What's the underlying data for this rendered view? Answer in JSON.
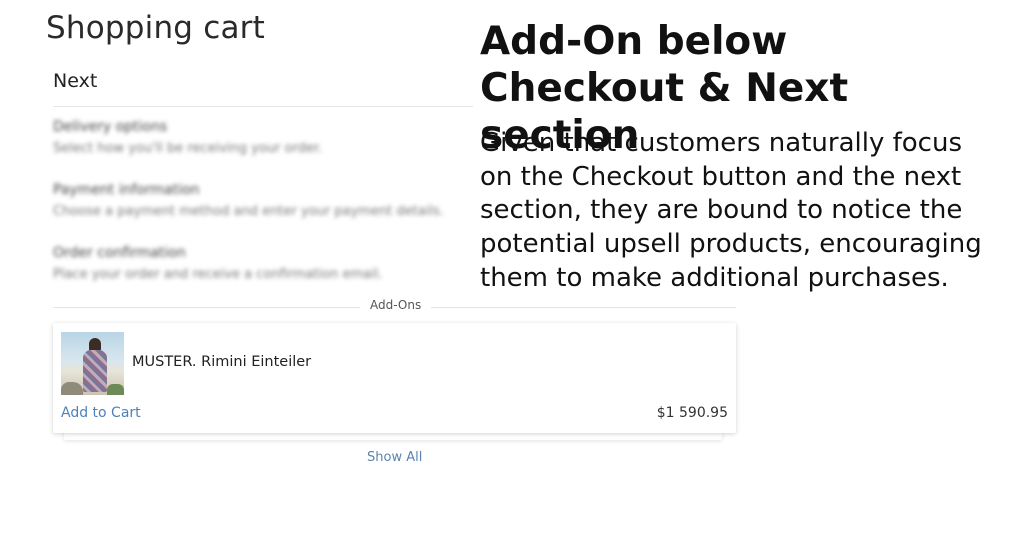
{
  "cart": {
    "title": "Shopping cart",
    "next_heading": "Next",
    "steps": [
      {
        "title": "Delivery options",
        "description": "Select how you'll be receiving your order."
      },
      {
        "title": "Payment information",
        "description": "Choose a payment method and enter your payment details."
      },
      {
        "title": "Order confirmation",
        "description": "Place your order and receive a confirmation email."
      }
    ]
  },
  "addons": {
    "label": "Add-Ons",
    "product": {
      "name": "MUSTER. Rimini Einteiler",
      "add_to_cart_label": "Add to Cart",
      "price": "$1 590.95",
      "thumbnail_icon": "product-photo"
    },
    "show_all_label": "Show All"
  },
  "annotation": {
    "headline": "Add-On below Checkout & Next section",
    "description": "Given that customers naturally focus on the Checkout button and the next section, they are bound to notice the potential upsell products, encouraging them to make additional purchases."
  },
  "colors": {
    "link": "#4f81b9",
    "text": "#111111"
  }
}
